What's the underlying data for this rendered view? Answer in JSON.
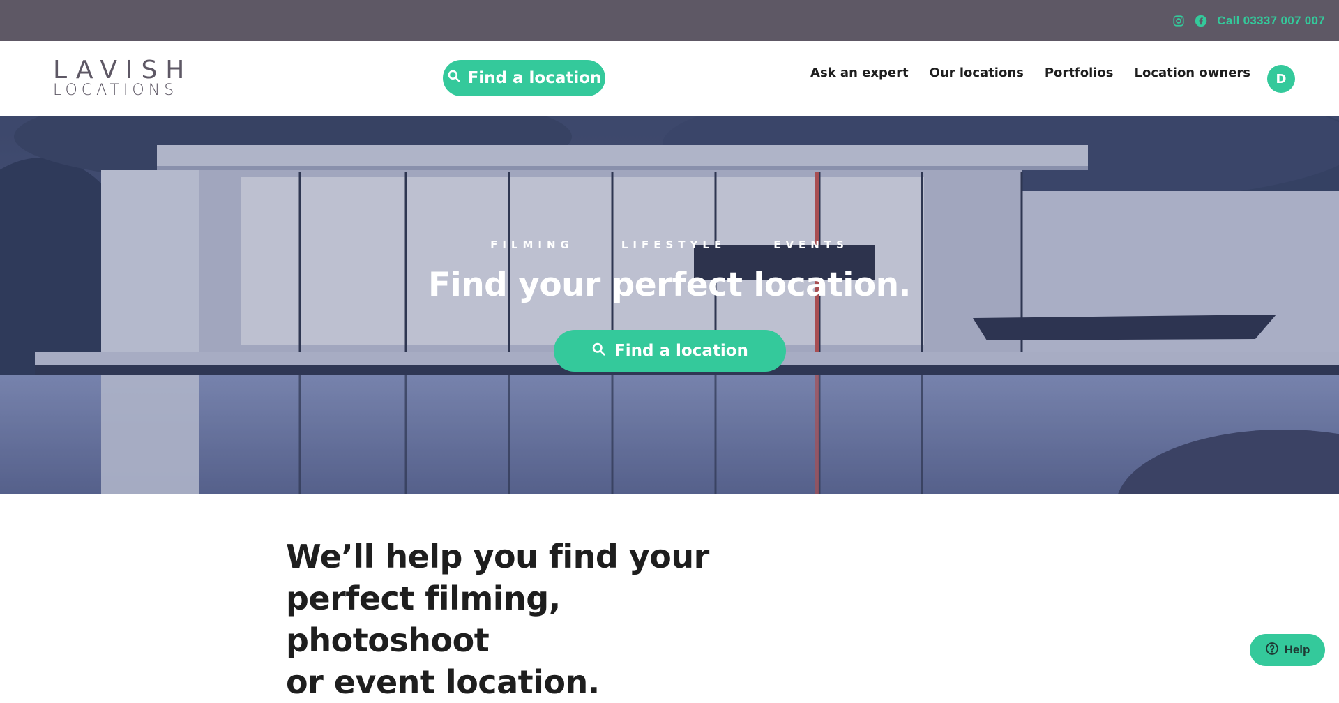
{
  "topbar": {
    "instagram_icon": "instagram-icon",
    "facebook_icon": "facebook-icon",
    "call_label": "Call 03337 007 007"
  },
  "header": {
    "logo_top": "LAVISH",
    "logo_bottom": "LOCATIONS",
    "cta_label": "Find a location",
    "nav": [
      {
        "label": "Ask an expert"
      },
      {
        "label": "Our locations"
      },
      {
        "label": "Portfolios"
      },
      {
        "label": "Location owners"
      }
    ],
    "avatar_initial": "D"
  },
  "hero": {
    "tags": [
      "FILMING",
      "LIFESTYLE",
      "EVENTS"
    ],
    "title": "Find your perfect location.",
    "cta_label": "Find a location"
  },
  "intro": {
    "line1": "We’ll help you find your",
    "line2": "perfect filming, photoshoot",
    "line3": "or event location."
  },
  "help": {
    "label": "Help"
  },
  "colors": {
    "accent": "#34c99b",
    "topbar": "#5e5865",
    "text": "#1e1e1e"
  }
}
